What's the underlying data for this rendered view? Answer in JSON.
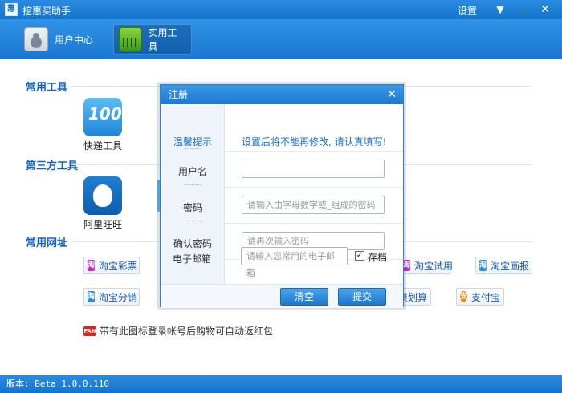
{
  "app": {
    "title": "挖惠买助手",
    "icon_glyph": "惠",
    "settings": "设置",
    "window_controls": {
      "dropdown": "▼",
      "minimize": "—",
      "close": "✕"
    }
  },
  "nav": {
    "tabs": [
      {
        "label": "用户中心",
        "icon": "address-book-icon",
        "active": false
      },
      {
        "label": "实用工具",
        "icon": "basket-icon",
        "active": true
      }
    ]
  },
  "sections": {
    "common_tools": {
      "title": "常用工具",
      "items": [
        {
          "label": "快递工具",
          "icon": "kuaidi-icon",
          "icon_text": "100"
        }
      ]
    },
    "third_party": {
      "title": "第三方工具",
      "items": [
        {
          "label": "阿里旺旺",
          "icon": "wangwang-icon"
        }
      ]
    },
    "common_sites": {
      "title": "常用网址",
      "links": [
        {
          "label": "淘宝彩票",
          "icon": "taobao-icon",
          "glyph": "淘"
        },
        {
          "label": "淘宝分销",
          "icon": "taobao-icon",
          "glyph": "淘"
        },
        {
          "label": "淘宝试用",
          "icon": "taobao-icon",
          "glyph": "淘"
        },
        {
          "label": "淘宝画报",
          "icon": "taobao-icon",
          "glyph": "淘"
        },
        {
          "label": "聚划算",
          "visible_label": "聚划算",
          "icon": "juhuasuan-icon"
        },
        {
          "label": "支付宝",
          "icon": "alipay-icon",
          "glyph": "支"
        }
      ]
    },
    "promo": {
      "badge": "FAN",
      "text": "带有此图标登录帐号后购物可自动返红包"
    }
  },
  "status": {
    "version_text": "版本: Beta 1.0.0.110"
  },
  "dialog": {
    "title": "注册",
    "close": "✕",
    "tip_label": "温馨提示",
    "tip_text": "设置后将不能再修改, 请认真填写!",
    "fields": {
      "username": {
        "label": "用户名",
        "value": "",
        "placeholder": ""
      },
      "password": {
        "label": "密码",
        "value": "请输入由字母数字或_组成的密码"
      },
      "confirm": {
        "label": "确认密码",
        "value": "请再次输入密码"
      },
      "email": {
        "label": "电子邮箱",
        "value": "请输入您常用的电子邮箱"
      }
    },
    "save_checkbox": {
      "label": "存档",
      "checked": true,
      "mark": "✓"
    },
    "buttons": {
      "clear": "清空",
      "submit": "提交"
    }
  },
  "colors": {
    "titlebar": "#1a7ad4",
    "section_title": "#1464c0",
    "button_blue": "#2a8ce0"
  }
}
